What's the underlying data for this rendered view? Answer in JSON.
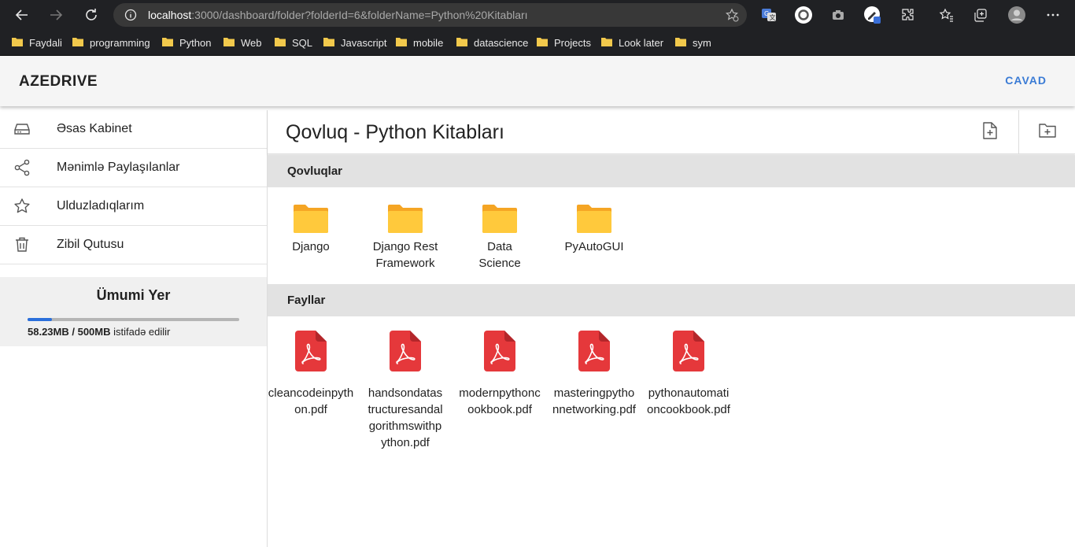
{
  "browser": {
    "url_host": "localhost",
    "url_rest": ":3000/dashboard/folder?folderId=6&folderName=Python%20Kitabları",
    "bookmarks": [
      "Faydali",
      "programming",
      "Python",
      "Web",
      "SQL",
      "Javascript",
      "mobile",
      "datascience",
      "Projects",
      "Look later",
      "sym"
    ]
  },
  "header": {
    "brand": "AZEDRIVE",
    "logout": "CAVAD"
  },
  "sidebar": {
    "items": [
      {
        "label": "Əsas Kabinet",
        "icon": "drive-icon"
      },
      {
        "label": "Mənimlə Paylaşılanlar",
        "icon": "share-icon"
      },
      {
        "label": "Ulduzladıqlarım",
        "icon": "star-icon"
      },
      {
        "label": "Zibil Qutusu",
        "icon": "trash-icon"
      }
    ],
    "storage": {
      "title": "Ümumi Yer",
      "used": "58.23MB / 500MB",
      "suffix": "istifadə edilir",
      "fraction": 0.116
    }
  },
  "main": {
    "title": "Qovluq - Python Kitabları",
    "folders_label": "Qovluqlar",
    "files_label": "Fayllar",
    "folders": [
      "Django",
      "Django Rest Framework",
      "Data Science",
      "PyAutoGUI"
    ],
    "files": [
      "cleancodeinpython.pdf",
      "handsondatastructuresandalgorithmswithpython.pdf",
      "modernpythoncookbook.pdf",
      "masteringpythonnetworking.pdf",
      "pythonautomationcookbook.pdf"
    ]
  },
  "colors": {
    "accent": "#3a7bd5",
    "folder": "#f5b324",
    "pdf": "#e5383b",
    "chrome": "#202124"
  }
}
